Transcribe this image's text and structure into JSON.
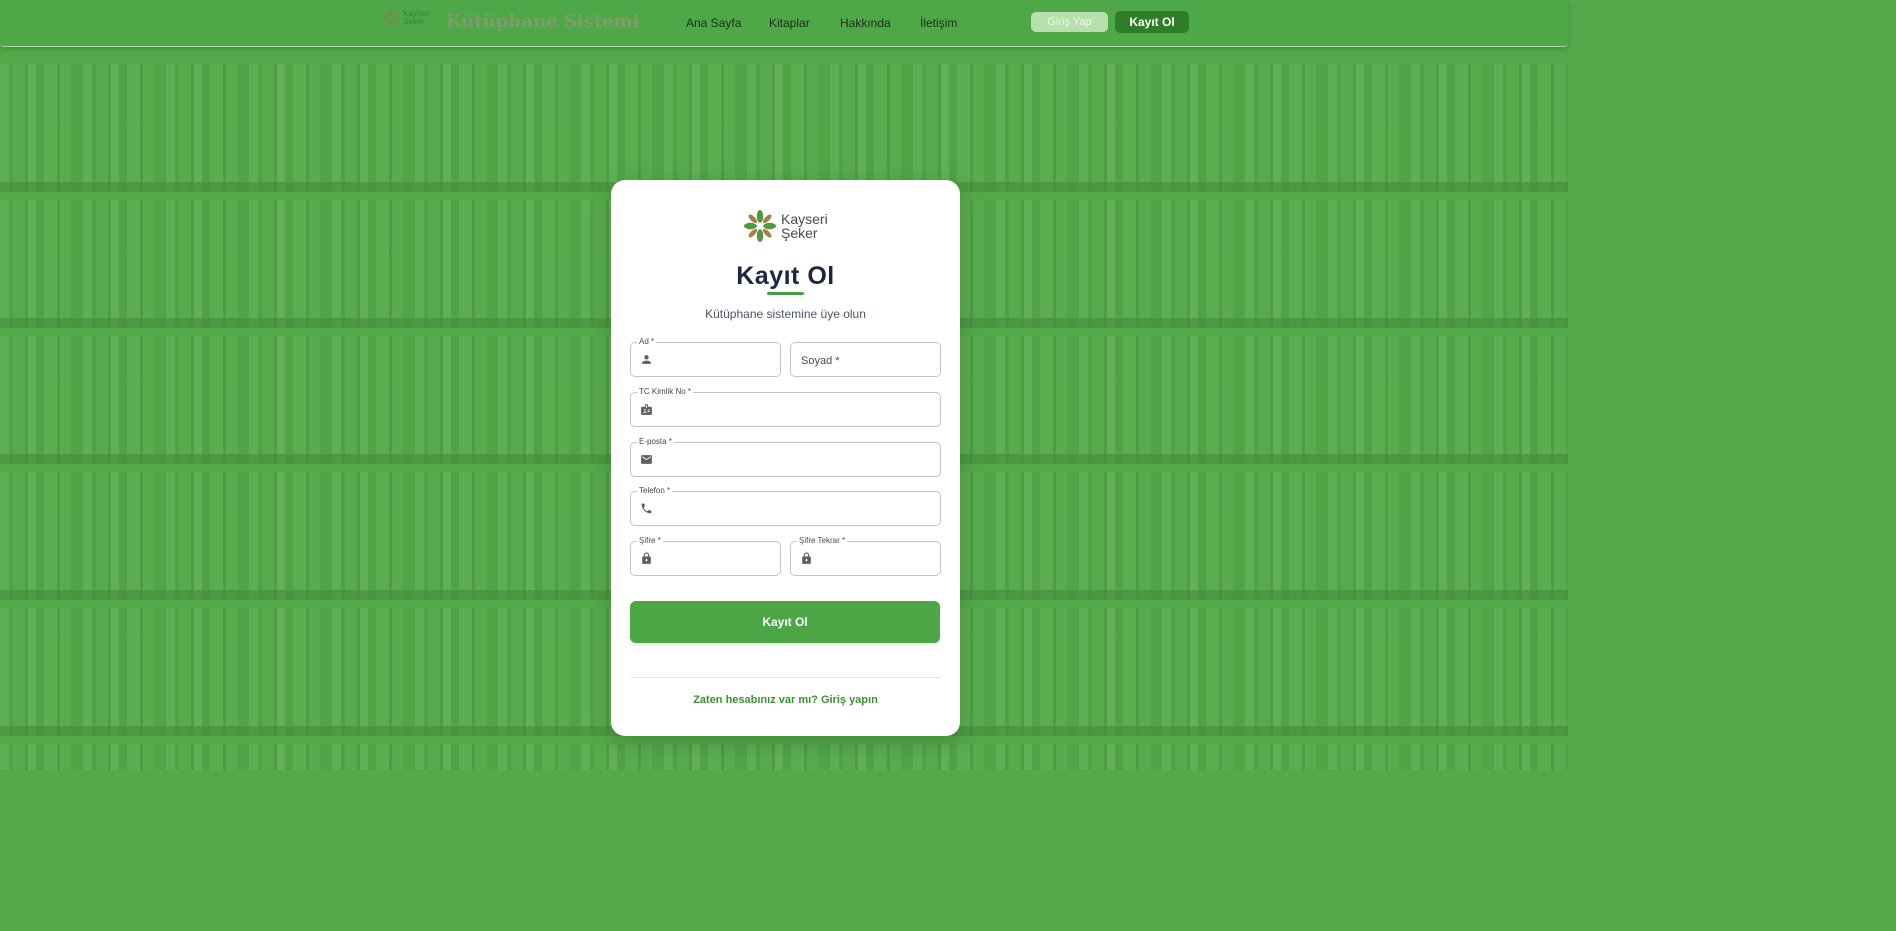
{
  "navbar": {
    "brand_logo_line1": "Kayseri",
    "brand_logo_line2": "Şeker",
    "brand_title": "Kütüphane Sistemi",
    "links": [
      "Ana Sayfa",
      "Kitaplar",
      "Hakkında",
      "İletişim"
    ],
    "login_label": "Giriş Yap",
    "register_label": "Kayıt Ol"
  },
  "card": {
    "logo_line1": "Kayseri",
    "logo_line2": "Şeker",
    "title": "Kayıt Ol",
    "subtitle": "Kütüphane sistemine üye olun",
    "fields": {
      "first_name": {
        "label": "Ad *",
        "icon": "person-icon",
        "value": ""
      },
      "last_name": {
        "placeholder": "Soyad *",
        "value": ""
      },
      "tc_no": {
        "label": "TC Kimlik No *",
        "icon": "id-badge-icon",
        "value": ""
      },
      "email": {
        "label": "E-posta *",
        "icon": "mail-icon",
        "value": ""
      },
      "phone": {
        "label": "Telefon *",
        "icon": "phone-icon",
        "value": ""
      },
      "password": {
        "label": "Şifre *",
        "icon": "lock-icon",
        "value": ""
      },
      "password_repeat": {
        "label": "Şifre Tekrar *",
        "icon": "lock-icon",
        "value": ""
      }
    },
    "submit_label": "Kayıt Ol",
    "login_prompt": "Zaten hesabınız var mı? Giriş yapın"
  },
  "colors": {
    "primary": "#4ca646",
    "primary_dark": "#2e7d27",
    "title_text": "#1e2540",
    "background_green": "#55a94a"
  }
}
